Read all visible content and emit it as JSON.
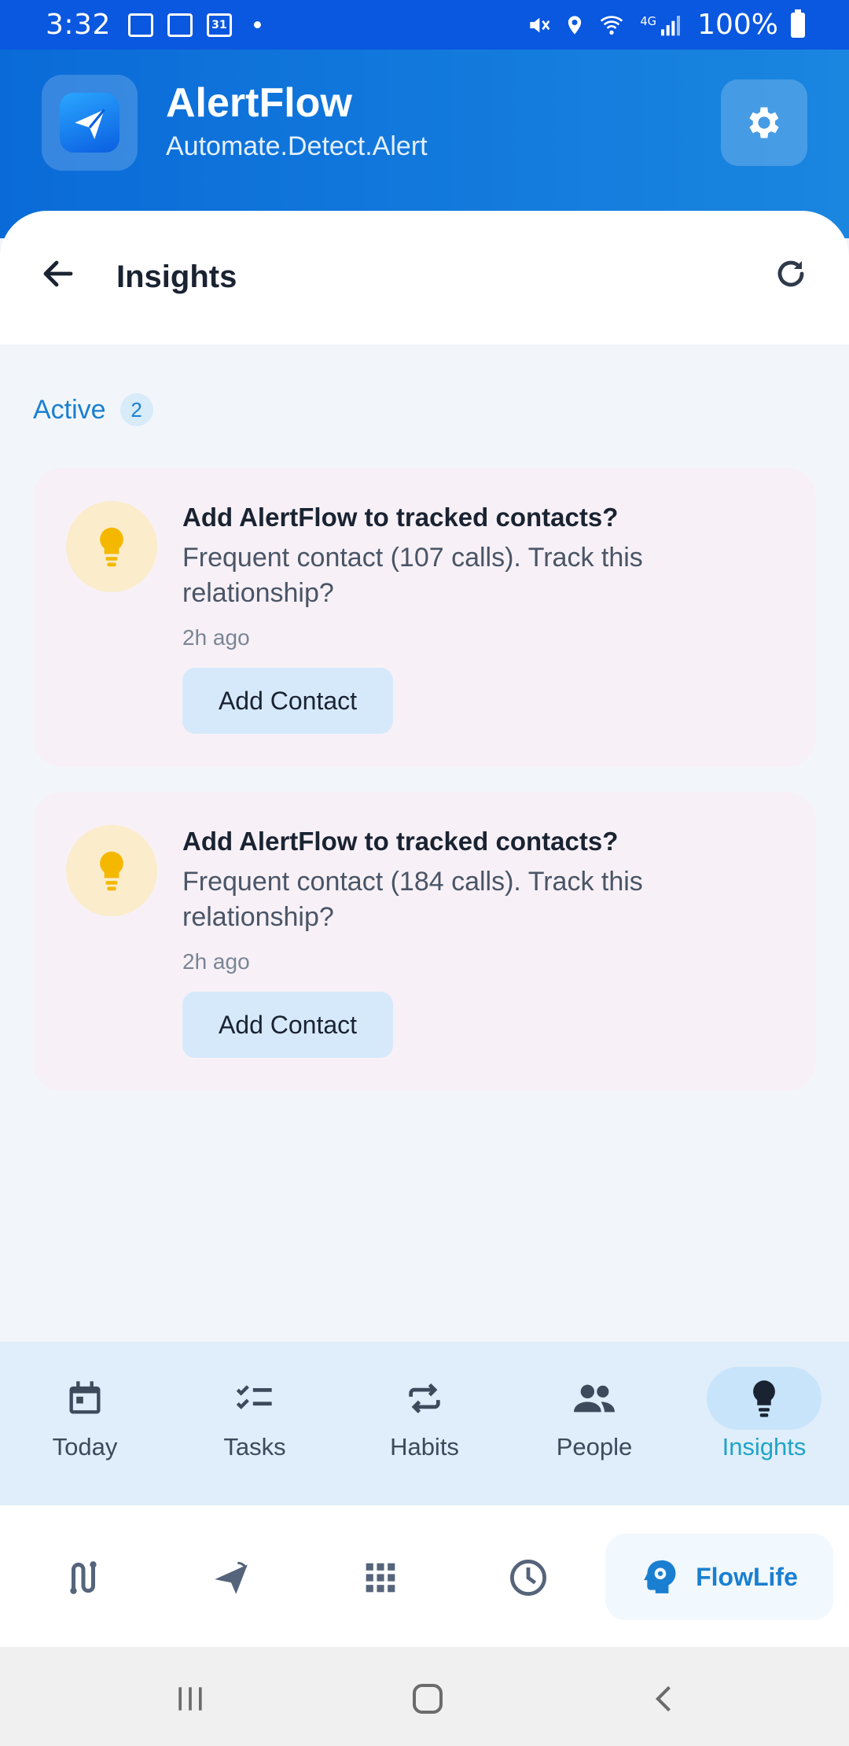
{
  "status_bar": {
    "time": "3:32",
    "calendar_day": "31",
    "battery": "100%"
  },
  "app": {
    "title": "AlertFlow",
    "subtitle": "Automate.Detect.Alert"
  },
  "page": {
    "title": "Insights"
  },
  "section": {
    "label": "Active",
    "count": "2"
  },
  "cards": [
    {
      "title": "Add AlertFlow to tracked contacts?",
      "body": "Frequent contact (107 calls). Track this relationship?",
      "time": "2h ago",
      "button": "Add Contact"
    },
    {
      "title": "Add AlertFlow to tracked contacts?",
      "body": "Frequent contact (184 calls). Track this relationship?",
      "time": "2h ago",
      "button": "Add Contact"
    }
  ],
  "bottom_nav": [
    {
      "label": "Today",
      "icon": "calendar-icon"
    },
    {
      "label": "Tasks",
      "icon": "checklist-icon"
    },
    {
      "label": "Habits",
      "icon": "repeat-icon"
    },
    {
      "label": "People",
      "icon": "people-icon"
    },
    {
      "label": "Insights",
      "icon": "lightbulb-icon",
      "active": true
    }
  ],
  "switcher": {
    "items": [
      "route-icon",
      "paper-plane-icon",
      "grid-icon",
      "clock-icon"
    ],
    "active_label": "FlowLife"
  },
  "colors": {
    "status_bar": "#0a57e0",
    "header": "#0a6bd8",
    "accent": "#1a7fd0",
    "active_tab": "#1fa3c8",
    "card_bg": "#f7f1f7",
    "bulb": "#f5b800"
  }
}
